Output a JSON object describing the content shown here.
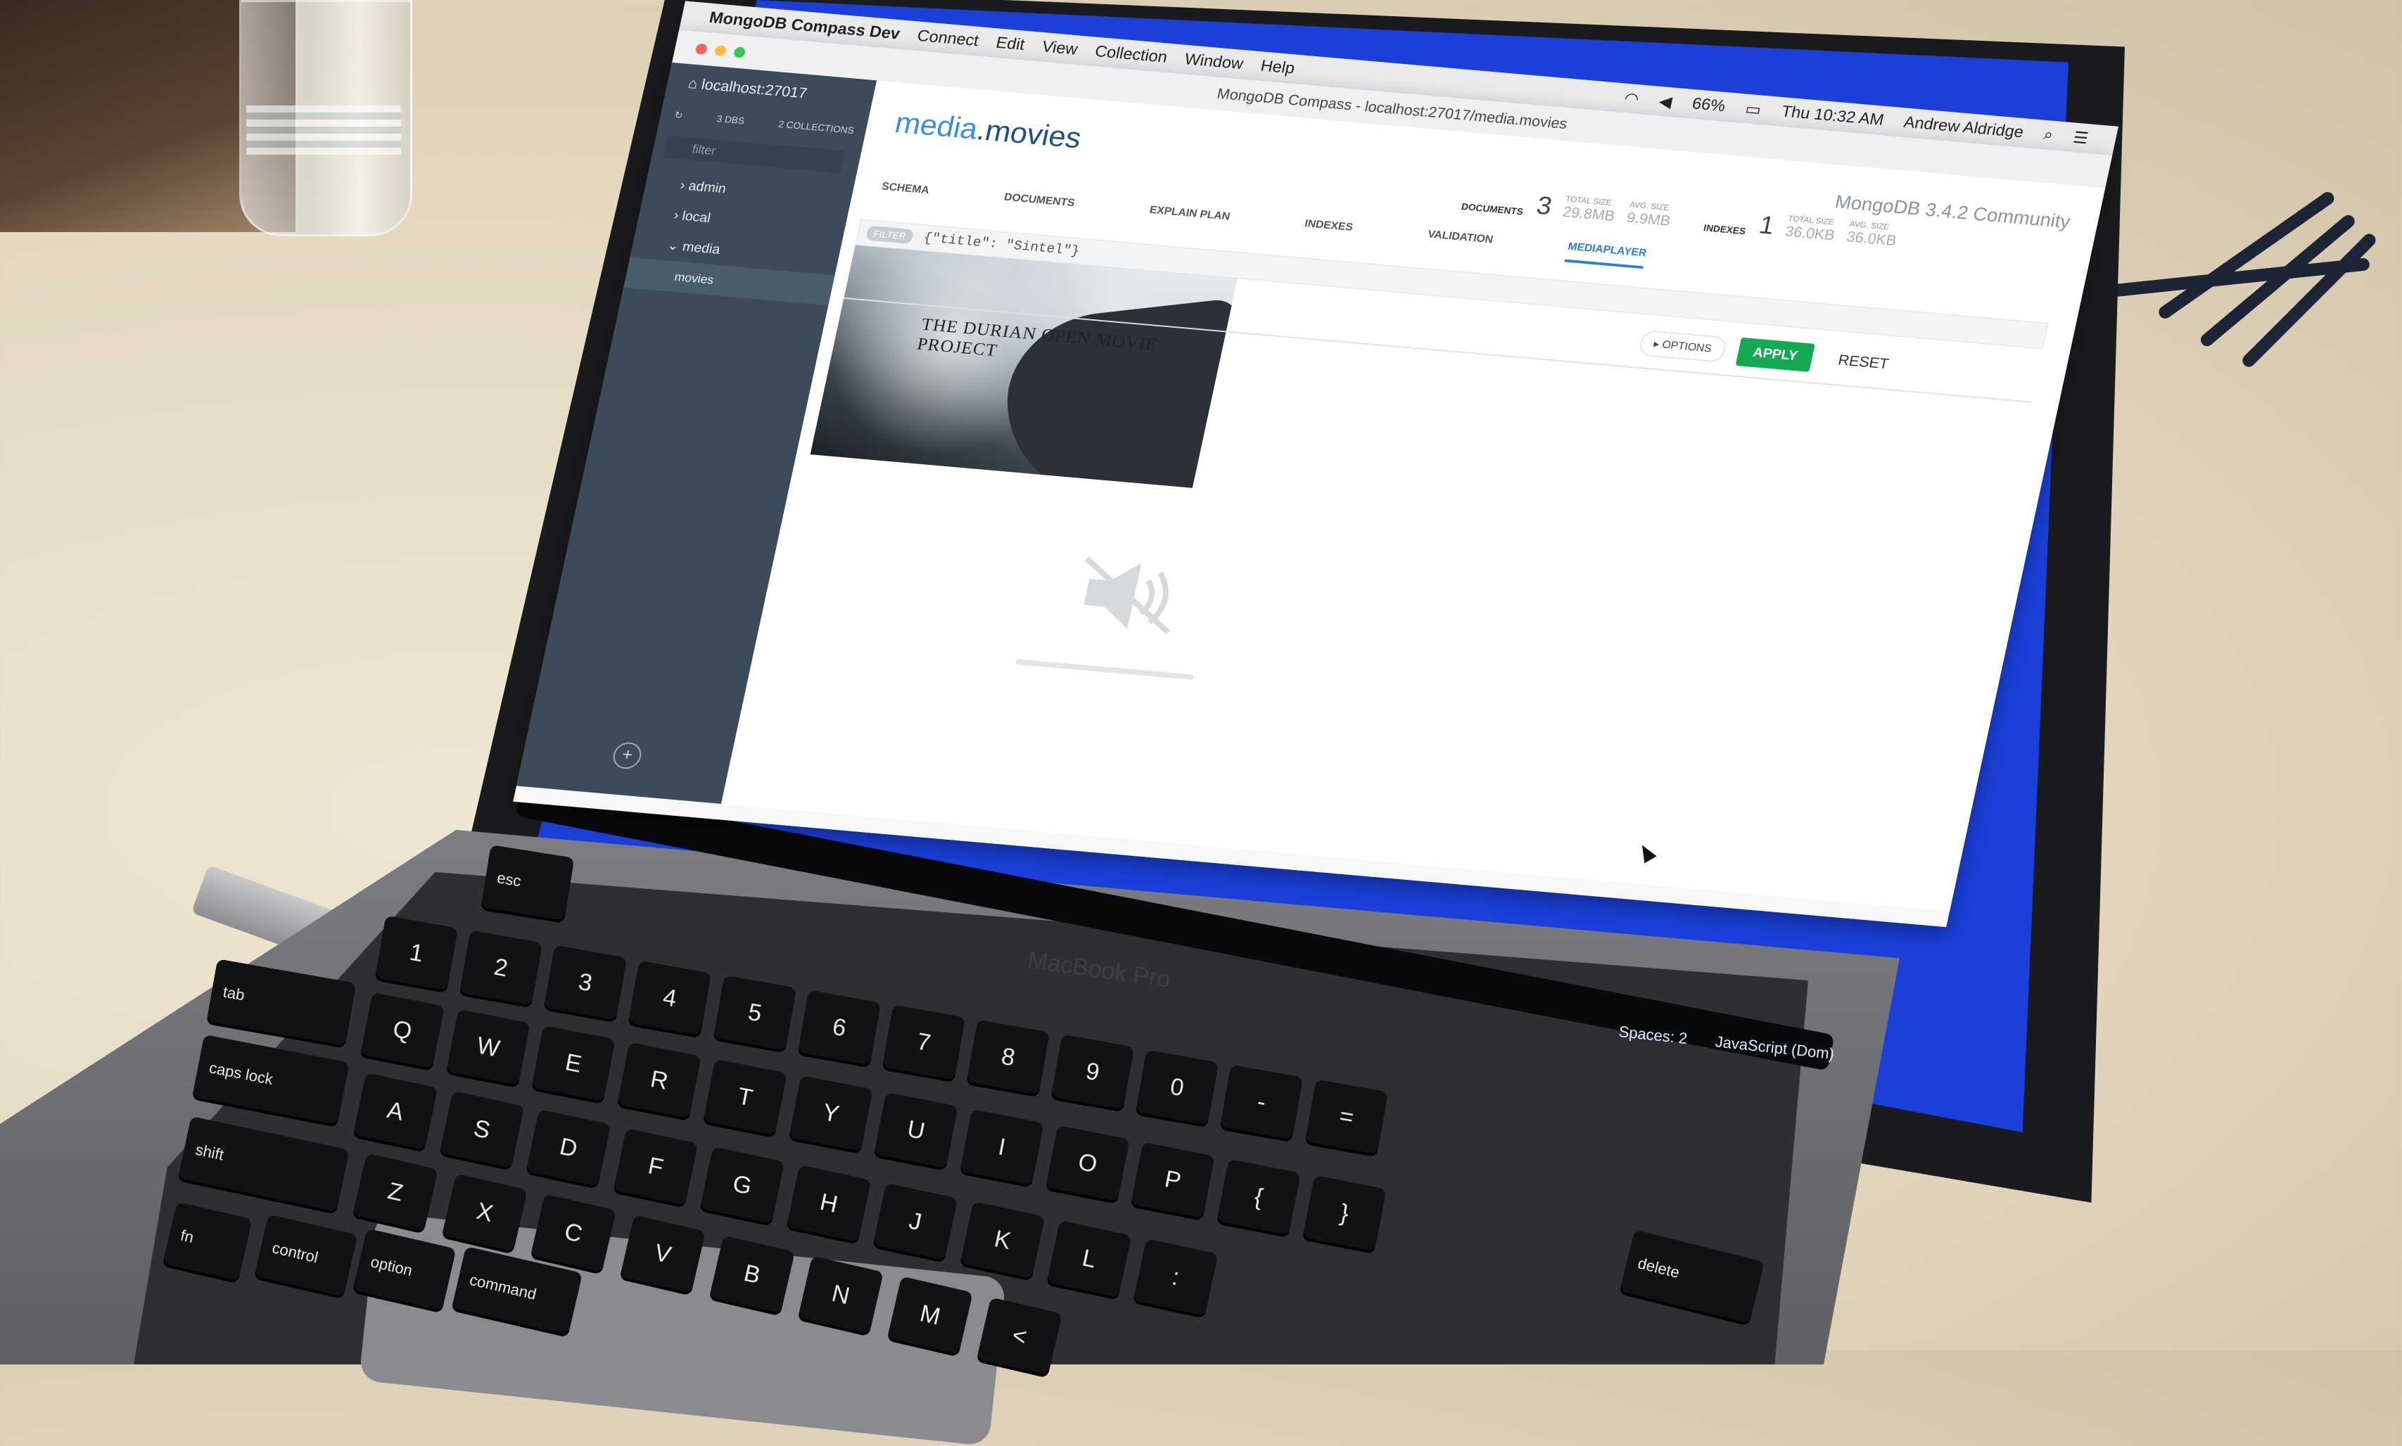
{
  "menubar": {
    "app": "MongoDB Compass Dev",
    "items": [
      "Connect",
      "Edit",
      "View",
      "Collection",
      "Window",
      "Help"
    ],
    "battery": "66%",
    "clock": "Thu 10:32 AM",
    "user": "Andrew Aldridge"
  },
  "window": {
    "title": "MongoDB Compass - localhost:27017/media.movies"
  },
  "sidebar": {
    "host": "localhost:27017",
    "dbs_count": "3 DBS",
    "collections_count": "2 COLLECTIONS",
    "filter_placeholder": "filter",
    "items": [
      {
        "label": "admin"
      },
      {
        "label": "local"
      },
      {
        "label": "media"
      },
      {
        "label": "movies"
      }
    ],
    "add": "+"
  },
  "main": {
    "namespace_db": "media",
    "namespace_coll": ".movies",
    "version": "MongoDB 3.4.2 Community",
    "stats": {
      "documents_label": "DOCUMENTS",
      "documents_value": "3",
      "doc_total_size_label": "TOTAL SIZE",
      "doc_total_size_value": "29.8MB",
      "doc_avg_size_label": "AVG. SIZE",
      "doc_avg_size_value": "9.9MB",
      "indexes_label": "INDEXES",
      "indexes_value": "1",
      "idx_total_size_label": "TOTAL SIZE",
      "idx_total_size_value": "36.0KB",
      "idx_avg_size_label": "AVG. SIZE",
      "idx_avg_size_value": "36.0KB"
    },
    "tabs": [
      "SCHEMA",
      "DOCUMENTS",
      "EXPLAIN PLAN",
      "INDEXES",
      "VALIDATION",
      "MEDIAPLAYER"
    ],
    "active_tab": "MEDIAPLAYER",
    "filter_badge": "FILTER",
    "filter_query": "{\"title\": \"Sintel\"}",
    "options_label": "OPTIONS",
    "apply_label": "APPLY",
    "reset_label": "RESET",
    "video_title": "THE DURIAN OPEN MOVIE PROJECT"
  },
  "editor": {
    "spaces": "Spaces: 2",
    "language": "JavaScript (Dom)"
  },
  "laptop": {
    "brand": "MacBook Pro"
  },
  "keyboard": {
    "row1": [
      "1",
      "2",
      "3",
      "4",
      "5",
      "6",
      "7",
      "8",
      "9",
      "0",
      "-",
      "="
    ],
    "row2": [
      "Q",
      "W",
      "E",
      "R",
      "T",
      "Y",
      "U",
      "I",
      "O",
      "P",
      "{",
      "}"
    ],
    "row3": [
      "A",
      "S",
      "D",
      "F",
      "G",
      "H",
      "J",
      "K",
      "L",
      ":"
    ],
    "row4": [
      "Z",
      "X",
      "C",
      "V",
      "B",
      "N",
      "M",
      "<"
    ],
    "mods": {
      "tab": "tab",
      "caps": "caps lock",
      "shift": "shift",
      "fn": "fn",
      "control": "control",
      "option": "option",
      "command": "command",
      "delete": "delete",
      "esc": "esc"
    }
  },
  "colors": {
    "accent": "#2b7fd0",
    "apply_green": "#13aa52",
    "sidebar": "#3b4b5a",
    "desktop_blue": "#1b3fd8"
  }
}
